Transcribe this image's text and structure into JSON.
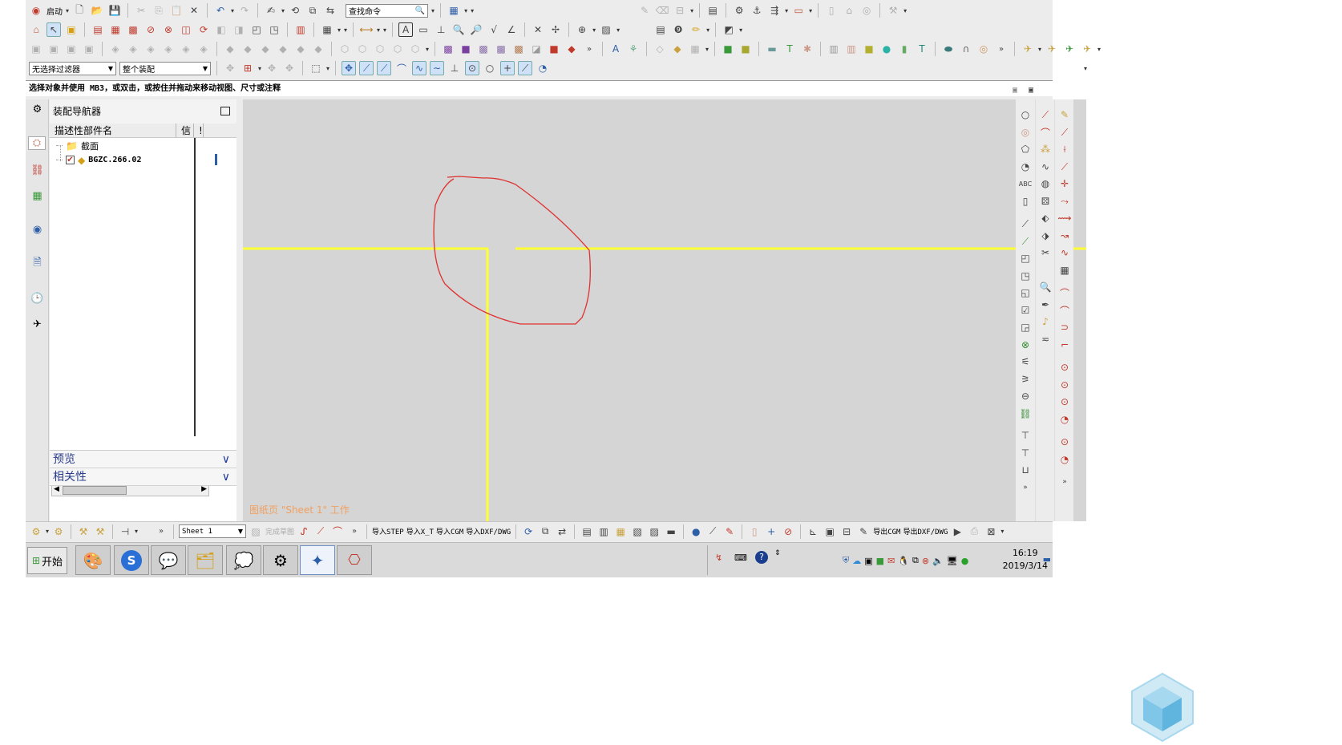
{
  "toolbar": {
    "start_menu_label": "启动",
    "search_command_placeholder": "查找命令",
    "selection_filter": "无选择过滤器",
    "assembly_scope": "整个装配"
  },
  "status_message": "选择对象并使用 MB3，或双击，或按住并拖动来移动视图、尺寸或注释",
  "navigator": {
    "title": "装配导航器",
    "columns": [
      "描述性部件名",
      "信",
      "!"
    ],
    "tree": [
      {
        "label": "截面",
        "type": "folder"
      },
      {
        "label": "BGZC.266.02",
        "type": "part",
        "checked": true
      }
    ],
    "sections": [
      "预览",
      "相关性"
    ]
  },
  "canvas": {
    "sheet_label": "图纸页 \"Sheet 1\" 工作",
    "background": "#d5d5d5",
    "line_color": "#ffff33",
    "annotation_color": "#e03030"
  },
  "bottom_toolbar": {
    "sheet_select": "Sheet 1",
    "sketch_done": "完成草图",
    "buttons": [
      "导入STEP",
      "导入X_T",
      "导入CGM",
      "导入DXF/DWG",
      "导出CGM",
      "导出DXF/DWG"
    ]
  },
  "taskbar": {
    "start_label": "开始",
    "time": "16:19",
    "date": "2019/3/14"
  }
}
